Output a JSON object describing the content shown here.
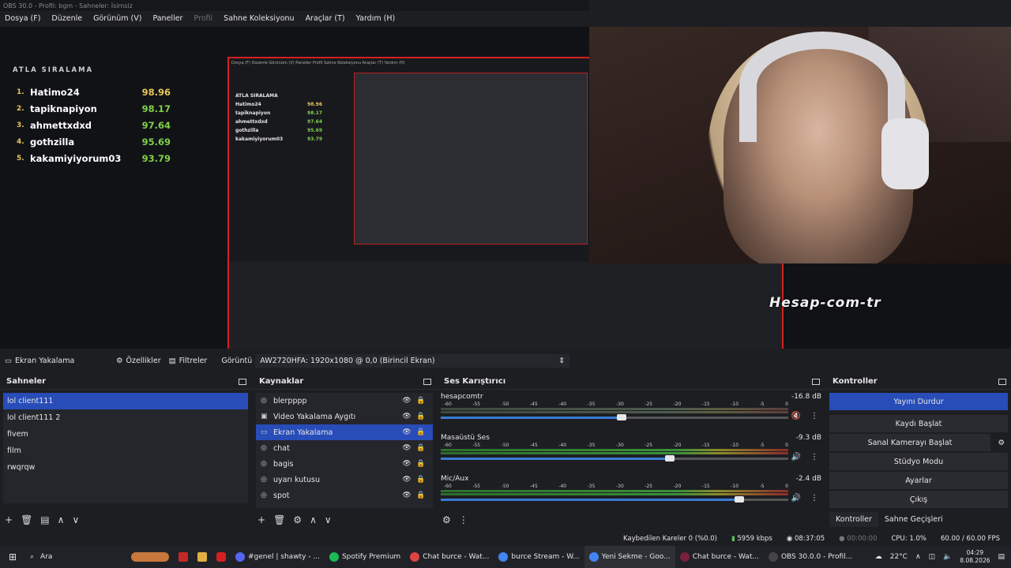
{
  "window": {
    "title": "OBS 30.0 - Profil: bgm - Sahneler: İsimsiz"
  },
  "menu": [
    "Dosya (F)",
    "Düzenle",
    "Görünüm (V)",
    "Paneller",
    "Profil",
    "Sahne Koleksiyonu",
    "Araçlar (T)",
    "Yardım (H)"
  ],
  "leaderboard": {
    "title": "ATLA SIRALAMA",
    "rows": [
      {
        "rank": "1.",
        "name": "Hatimo24",
        "score": "98.96",
        "color": "#e8c65a"
      },
      {
        "rank": "2.",
        "name": "tapiknapiyon",
        "score": "98.17",
        "color": "#7fd04a"
      },
      {
        "rank": "3.",
        "name": "ahmettxdxd",
        "score": "97.64",
        "color": "#7fd04a"
      },
      {
        "rank": "4.",
        "name": "gothzilla",
        "score": "95.69",
        "color": "#7fd04a"
      },
      {
        "rank": "5.",
        "name": "kakamiyiyorum03",
        "score": "93.79",
        "color": "#7fd04a"
      }
    ]
  },
  "watermark": "Hesap-com-tr",
  "source_bar": {
    "source": "Ekran Yakalama",
    "properties": "Özellikler",
    "filters": "Filtreler",
    "display_label": "Görüntü",
    "display_value": "AW2720HFA: 1920x1080 @ 0,0 (Birincil Ekran)"
  },
  "scenes": {
    "title": "Sahneler",
    "items": [
      "lol client111",
      "lol client111 2",
      "fivem",
      "film",
      "rwqrqw"
    ],
    "selected": 0
  },
  "sources": {
    "title": "Kaynaklar",
    "items": [
      {
        "name": "blerpppp",
        "icon": "globe-icon"
      },
      {
        "name": "Video Yakalama Aygıtı",
        "icon": "camera-icon"
      },
      {
        "name": "Ekran Yakalama",
        "icon": "monitor-icon"
      },
      {
        "name": "chat",
        "icon": "globe-icon"
      },
      {
        "name": "bagis",
        "icon": "globe-icon"
      },
      {
        "name": "uyarı kutusu",
        "icon": "globe-icon"
      },
      {
        "name": "spot",
        "icon": "globe-icon"
      }
    ],
    "selected": 2
  },
  "mixer": {
    "title": "Ses Karıştırıcı",
    "ticks": [
      "-60",
      "-55",
      "-50",
      "-45",
      "-40",
      "-35",
      "-30",
      "-25",
      "-20",
      "-15",
      "-10",
      "-5",
      "0"
    ],
    "channels": [
      {
        "name": "hesapcomtr",
        "db": "-16.8 dB",
        "volume": 0.52,
        "muted": true
      },
      {
        "name": "Masaüstü Ses",
        "db": "-9.3 dB",
        "volume": 0.66,
        "muted": false
      },
      {
        "name": "Mic/Aux",
        "db": "-2.4 dB",
        "volume": 0.86,
        "muted": false
      }
    ]
  },
  "controls": {
    "title": "Kontroller",
    "buttons": [
      "Yayını Durdur",
      "Kaydı Başlat",
      "Sanal Kamerayı Başlat",
      "Stüdyo Modu",
      "Ayarlar",
      "Çıkış"
    ],
    "tabs": [
      "Kontroller",
      "Sahne Geçişleri"
    ]
  },
  "status": {
    "dropped": "Kaybedilen Kareler 0 (%0.0)",
    "bitrate": "5959 kbps",
    "stream_time": "08:37:05",
    "rec_time": "00:00:00",
    "cpu": "CPU: 1.0%",
    "fps": "60.00 / 60.00 FPS"
  },
  "taskbar": {
    "search": "Ara",
    "apps": [
      {
        "label": "#genel | shawty - ...",
        "color": "#5865f2"
      },
      {
        "label": "Spotify Premium",
        "color": "#1db954"
      },
      {
        "label": "Chat burce - Wat...",
        "color": "#d44"
      },
      {
        "label": "burce Stream - W...",
        "color": "#4285f4"
      },
      {
        "label": "Yeni Sekme - Goo...",
        "color": "#4285f4"
      },
      {
        "label": "Chat burce - Wat...",
        "color": "#7a1f3d"
      },
      {
        "label": "OBS 30.0.0 - Profil...",
        "color": "#444"
      }
    ],
    "weather": "22°C",
    "time": "04:29",
    "date": "8.08.2026"
  }
}
